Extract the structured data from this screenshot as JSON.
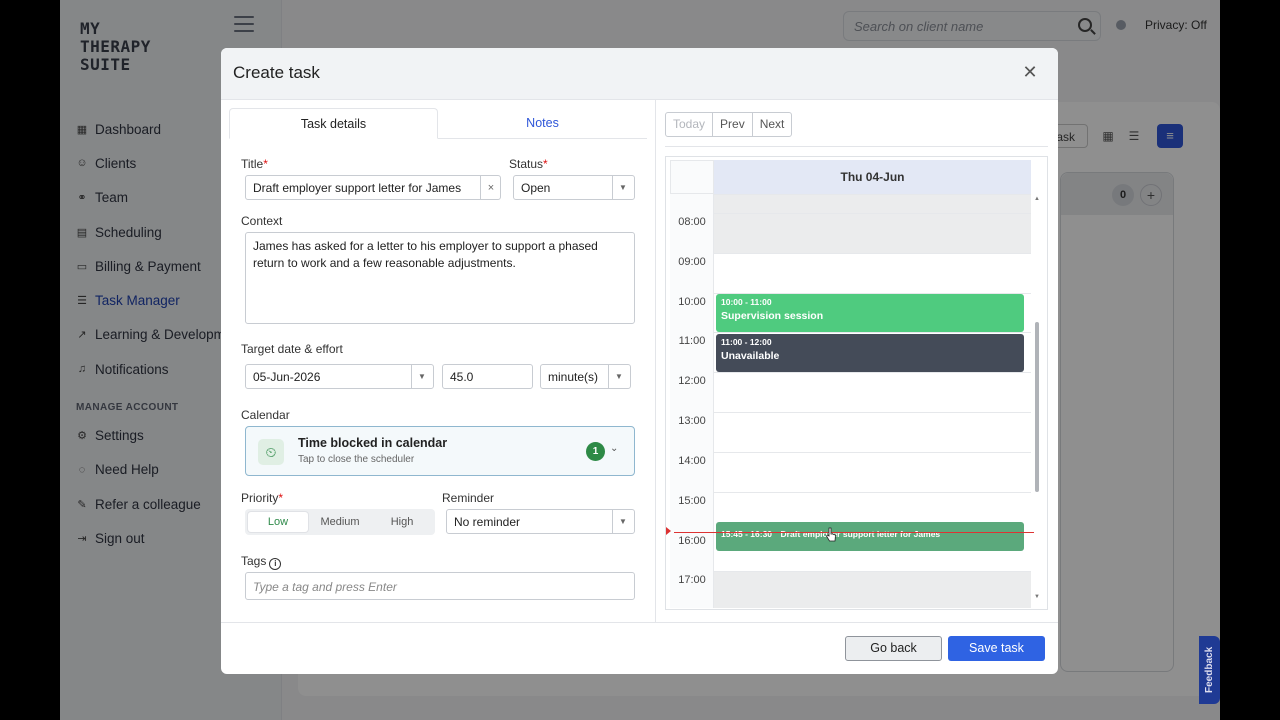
{
  "app": {
    "logo_lines": [
      "MY",
      "THERAPY",
      "SUITE"
    ]
  },
  "sidebar": {
    "items": [
      {
        "label": "Dashboard",
        "icon": "grid-icon"
      },
      {
        "label": "Clients",
        "icon": "people-icon"
      },
      {
        "label": "Team",
        "icon": "team-icon"
      },
      {
        "label": "Scheduling",
        "icon": "calendar-icon"
      },
      {
        "label": "Billing & Payment",
        "icon": "card-icon"
      },
      {
        "label": "Task Manager",
        "icon": "list-icon"
      },
      {
        "label": "Learning & Development",
        "icon": "chart-icon"
      },
      {
        "label": "Notifications",
        "icon": "bell-icon"
      }
    ],
    "section_label": "MANAGE ACCOUNT",
    "account_items": [
      {
        "label": "Settings",
        "icon": "gear-icon"
      },
      {
        "label": "Need Help",
        "icon": "help-icon"
      },
      {
        "label": "Refer a colleague",
        "icon": "megaphone-icon"
      },
      {
        "label": "Sign out",
        "icon": "signout-icon"
      }
    ]
  },
  "header": {
    "search_placeholder": "Search on client name",
    "privacy_label": "Privacy: Off"
  },
  "background": {
    "add_task_fragment": "task",
    "column_count": "0"
  },
  "feedback_label": "Feedback",
  "modal": {
    "title": "Create task",
    "tabs": [
      "Task details",
      "Notes"
    ],
    "title_label": "Title",
    "title_value": "Draft employer support letter for James",
    "status_label": "Status",
    "status_value": "Open",
    "context_label": "Context",
    "context_value": "James has asked for a letter to his employer to support a phased return to work and a few reasonable adjustments.",
    "target_label": "Target date & effort",
    "target_date": "05-Jun-2026",
    "effort_value": "45.0",
    "effort_unit": "minute(s)",
    "calendar_label": "Calendar",
    "calendar_title": "Time blocked in calendar",
    "calendar_sub": "Tap to close the scheduler",
    "calendar_badge": "1",
    "priority_label": "Priority",
    "priority_options": [
      "Low",
      "Medium",
      "High"
    ],
    "priority_selected": "Low",
    "reminder_label": "Reminder",
    "reminder_value": "No reminder",
    "tags_label": "Tags",
    "tags_placeholder": "Type a tag and press Enter",
    "nav_buttons": [
      "Today",
      "Prev",
      "Next"
    ],
    "day_header": "Thu 04-Jun",
    "time_slots": [
      "08:00",
      "09:00",
      "10:00",
      "11:00",
      "12:00",
      "13:00",
      "14:00",
      "15:00",
      "16:00",
      "17:00"
    ],
    "events": [
      {
        "time": "10:00 - 11:00",
        "name": "Supervision session",
        "color": "#4fcb7f"
      },
      {
        "time": "11:00 - 12:00",
        "name": "Unavailable",
        "color": "#444b58"
      },
      {
        "time": "15:45 - 16:30",
        "name": "Draft employer support letter for James",
        "color": "#5ba97c"
      }
    ],
    "back_button": "Go back",
    "save_button": "Save task"
  },
  "colors": {
    "accent": "#2f63e3",
    "success": "#2d8a46"
  }
}
